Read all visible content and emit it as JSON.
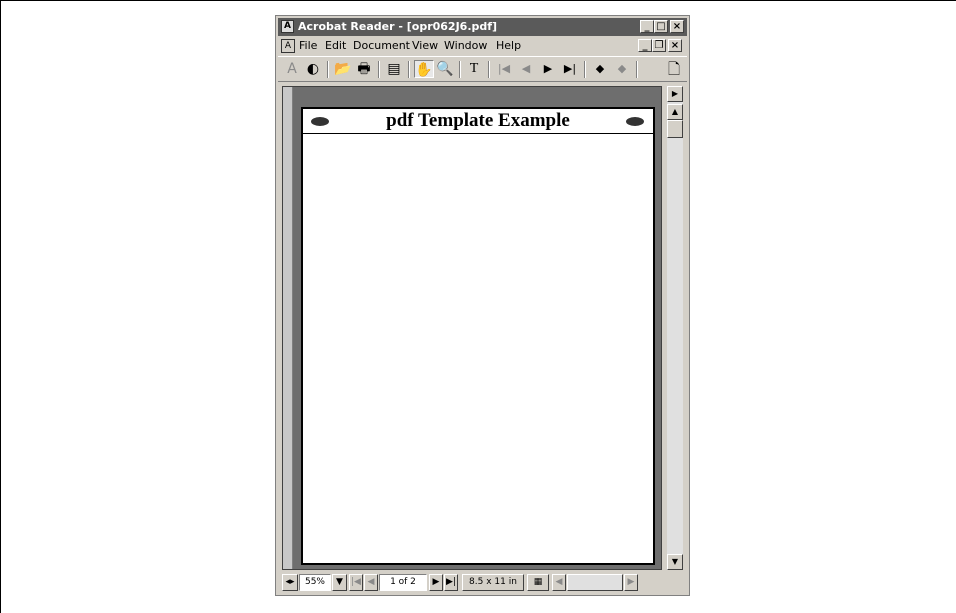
{
  "window": {
    "title": "Acrobat Reader - [opr062J6.pdf]",
    "controls": {
      "minimize": "_",
      "maximize": "□",
      "close": "×"
    },
    "doc_controls": {
      "minimize": "_",
      "restore": "❐",
      "close": "×"
    }
  },
  "menu": [
    {
      "label": "File"
    },
    {
      "label": "Edit"
    },
    {
      "label": "Document"
    },
    {
      "label": "View"
    },
    {
      "label": "Window"
    },
    {
      "label": "Help"
    }
  ],
  "toolbar": {
    "acrobat_icon": "A",
    "web_icon": "◐",
    "open_icon": "📂",
    "print_icon": "🖶",
    "page_only_icon": "▤",
    "hand_icon": "✋",
    "zoom_icon": "🔍",
    "text_select_icon": "T",
    "first_page_icon": "|◀",
    "prev_page_icon": "◀",
    "next_page_icon": "▶",
    "last_page_icon": "▶|",
    "go_back_icon": "◆",
    "go_forward_icon": "◆",
    "new_page_icon": "🗋"
  },
  "document": {
    "page_title": "pdf Template Example"
  },
  "scrollbar": {
    "right_arrow": "▶",
    "up_arrow": "▲",
    "down_arrow": "▼"
  },
  "status": {
    "zoom": "55%",
    "page_indicator": "1 of 2",
    "page_size": "8.5 x 11 in",
    "first": "|◀",
    "prev": "◀",
    "next": "▶",
    "last": "▶|",
    "zoom_dropdown": "▼",
    "move_left": "◀",
    "move_right": "▶",
    "split": "◂▸"
  }
}
